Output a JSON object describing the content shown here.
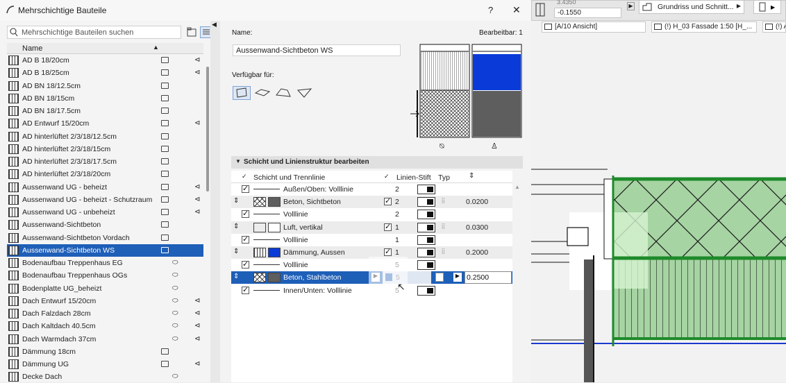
{
  "dialog": {
    "title": "Mehrschichtige Bauteile",
    "help": "?",
    "close": "✕",
    "search_placeholder": "Mehrschichtige Bauteilen suchen",
    "list_header": "Name",
    "items": [
      {
        "label": "AD B 18/20cm",
        "flag1": true,
        "flag2": true
      },
      {
        "label": "AD B 18/25cm",
        "flag1": true,
        "flag2": true
      },
      {
        "label": "AD BN 18/12.5cm",
        "flag1": true,
        "flag2": false
      },
      {
        "label": "AD BN 18/15cm",
        "flag1": true,
        "flag2": false
      },
      {
        "label": "AD BN 18/17.5cm",
        "flag1": true,
        "flag2": false
      },
      {
        "label": "AD Entwurf 15/20cm",
        "flag1": true,
        "flag2": true
      },
      {
        "label": "AD hinterlüftet 2/3/18/12.5cm",
        "flag1": true,
        "flag2": false
      },
      {
        "label": "AD hinterlüftet 2/3/18/15cm",
        "flag1": true,
        "flag2": false
      },
      {
        "label": "AD hinterlüftet 2/3/18/17.5cm",
        "flag1": true,
        "flag2": false
      },
      {
        "label": "AD hinterlüftet 2/3/18/20cm",
        "flag1": true,
        "flag2": false
      },
      {
        "label": "Aussenwand UG - beheizt",
        "flag1": true,
        "flag2": true
      },
      {
        "label": "Aussenwand UG - beheizt - Schutzraum",
        "flag1": true,
        "flag2": true
      },
      {
        "label": "Aussenwand UG - unbeheizt",
        "flag1": true,
        "flag2": true
      },
      {
        "label": "Aussenwand-Sichtbeton",
        "flag1": true,
        "flag2": false
      },
      {
        "label": "Aussenwand-Sichtbeton Vordach",
        "flag1": true,
        "flag2": false
      },
      {
        "label": "Aussenwand-Sichtbeton WS",
        "flag1": true,
        "flag2": false
      },
      {
        "label": "Bodenaufbau Treppenhaus EG",
        "flag1": false,
        "flag2": false
      },
      {
        "label": "Bodenaufbau Treppenhaus OGs",
        "flag1": false,
        "flag2": false
      },
      {
        "label": "Bodenplatte UG_beheizt",
        "flag1": false,
        "flag2": false
      },
      {
        "label": "Dach Entwurf 15/20cm",
        "flag1": false,
        "flag2": true
      },
      {
        "label": "Dach Falzdach 28cm",
        "flag1": false,
        "flag2": true
      },
      {
        "label": "Dach Kaltdach 40.5cm",
        "flag1": false,
        "flag2": true
      },
      {
        "label": "Dach Warmdach 37cm",
        "flag1": false,
        "flag2": true
      },
      {
        "label": "Dämmung 18cm",
        "flag1": true,
        "flag2": false
      },
      {
        "label": "Dämmung UG",
        "flag1": true,
        "flag2": true
      },
      {
        "label": "Decke Dach",
        "flag1": false,
        "flag2": false
      }
    ],
    "selected_index": 15,
    "name_label": "Name:",
    "editable_label": "Bearbeitbar: 1",
    "name_value": "Aussenwand-Sichtbeton WS",
    "available_label": "Verfügbar für:",
    "section_title": "Schicht und Linienstruktur bearbeiten",
    "table_headers": {
      "layer": "Schicht und Trennlinie",
      "pen": "Linien-Stift",
      "type": "Typ"
    },
    "rows": [
      {
        "kind": "line",
        "checked": true,
        "name": "Außen/Oben: Volllinie",
        "pen": "2",
        "thick": ""
      },
      {
        "kind": "layer",
        "fill": "hatch",
        "color": "gray",
        "name": "Beton, Sichtbeton",
        "pen": "2",
        "thick": "0.0200"
      },
      {
        "kind": "line",
        "checked": true,
        "name": "Volllinie",
        "pen": "2",
        "thick": ""
      },
      {
        "kind": "layer",
        "fill": "empty",
        "color": "empty",
        "name": "Luft, vertikal",
        "pen": "1",
        "thick": "0.0300"
      },
      {
        "kind": "line",
        "checked": true,
        "name": "Volllinie",
        "pen": "1",
        "thick": ""
      },
      {
        "kind": "layer",
        "fill": "vlines",
        "color": "blue",
        "name": "Dämmung, Aussen",
        "pen": "1",
        "thick": "0.2000"
      },
      {
        "kind": "line",
        "checked": true,
        "name": "Volllinie",
        "pen": "5",
        "thick": ""
      },
      {
        "kind": "selected",
        "fill": "hatch",
        "color": "gray",
        "name": "Beton, Stahlbeton",
        "pen": "5",
        "thick": "0.2500"
      },
      {
        "kind": "line",
        "checked": true,
        "name": "Innen/Unten: Volllinie",
        "pen": "5",
        "thick": ""
      }
    ]
  },
  "background_app": {
    "coord_top": "3.4350",
    "coord_value": "-0.1550",
    "view_dropdown": "Grundriss und Schnitt...",
    "tabs": [
      "[A/10 Ansicht]",
      "(!) H_03 Fassade 1:50 [H_...",
      "(!) A"
    ]
  },
  "colors": {
    "selection": "#1e5fb8",
    "insulation_blue": "#0a3bd8",
    "green_fill": "#a6d4a3"
  }
}
